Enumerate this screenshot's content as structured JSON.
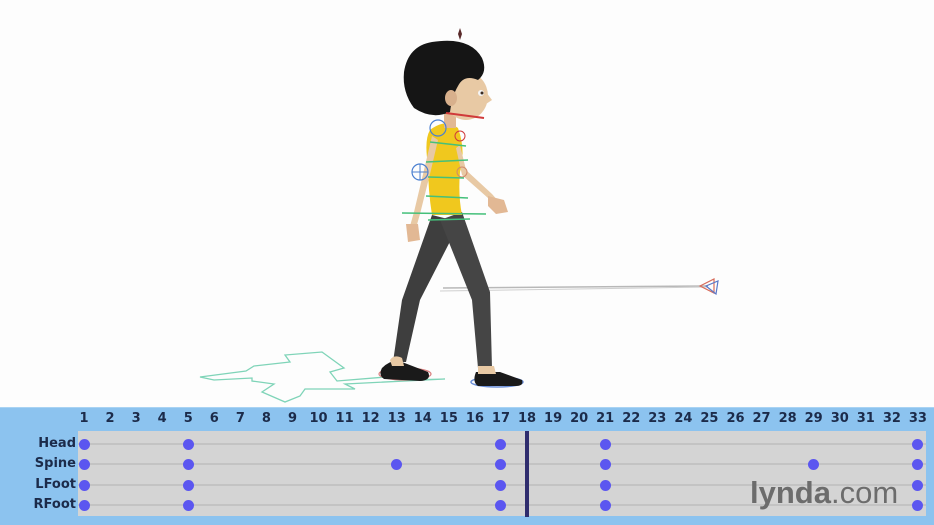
{
  "viewport": {
    "scene": "3d-character-walk-cycle",
    "character": "rigged-female-character",
    "colors": {
      "background": "#fdfdfd",
      "shirt": "#f0c81e",
      "pants": "#3e3e3e",
      "hair": "#151515",
      "skin": "#e8c9a4",
      "shoe": "#1a1a1a",
      "control_green": "#44c07a",
      "control_blue": "#4a7fd0",
      "control_red": "#d03a3a",
      "ground_control": "#7fd4b8"
    }
  },
  "timeline": {
    "frames": [
      "1",
      "2",
      "3",
      "4",
      "5",
      "6",
      "7",
      "8",
      "9",
      "10",
      "11",
      "12",
      "13",
      "14",
      "15",
      "16",
      "17",
      "18",
      "19",
      "20",
      "21",
      "22",
      "23",
      "24",
      "25",
      "26",
      "27",
      "28",
      "29",
      "30",
      "31",
      "32",
      "33"
    ],
    "current_frame": 18,
    "tracks": [
      {
        "label": "Head",
        "keys": [
          1,
          5,
          17,
          21,
          33
        ]
      },
      {
        "label": "Spine",
        "keys": [
          1,
          5,
          13,
          17,
          21,
          29,
          33
        ]
      },
      {
        "label": "LFoot",
        "keys": [
          1,
          5,
          17,
          21,
          33
        ]
      },
      {
        "label": "RFoot",
        "keys": [
          1,
          5,
          17,
          21,
          33
        ]
      }
    ],
    "colors": {
      "band": "#8cc3ef",
      "track_bg": "#d4d4d4",
      "keyframe": "#5b56f0",
      "playhead": "#2f2d6e",
      "label_text": "#1c2b4a"
    }
  },
  "watermark": {
    "brand": "lynda",
    "suffix": ".com"
  }
}
